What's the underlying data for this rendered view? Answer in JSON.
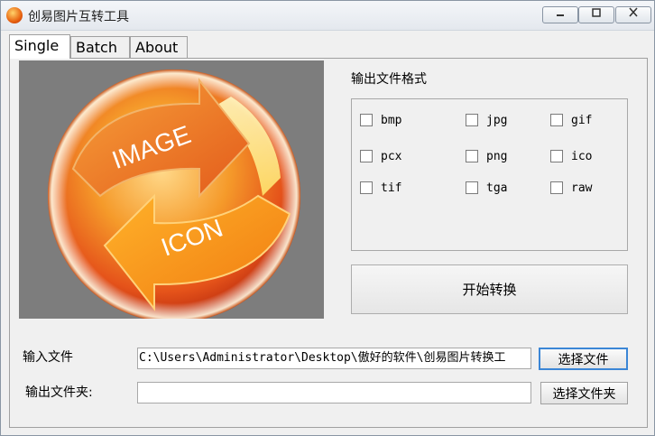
{
  "window": {
    "title": "创易图片互转工具",
    "minimize": "▭",
    "maximize": "□",
    "close": "✕"
  },
  "tabs": [
    {
      "label": "Single",
      "active": true
    },
    {
      "label": "Batch",
      "active": false
    },
    {
      "label": "About",
      "active": false
    }
  ],
  "logo": {
    "top_text": "IMAGE",
    "bottom_text": "ICON"
  },
  "formats": {
    "label": "输出文件格式",
    "options": [
      {
        "label": "bmp",
        "checked": false
      },
      {
        "label": "jpg",
        "checked": false
      },
      {
        "label": "gif",
        "checked": false
      },
      {
        "label": "pcx",
        "checked": false
      },
      {
        "label": "png",
        "checked": false
      },
      {
        "label": "ico",
        "checked": false
      },
      {
        "label": "tif",
        "checked": false
      },
      {
        "label": "tga",
        "checked": false
      },
      {
        "label": "raw",
        "checked": false
      }
    ]
  },
  "convert_button": "开始转换",
  "input_file": {
    "label": "输入文件",
    "value": "C:\\Users\\Administrator\\Desktop\\傲好的软件\\创易图片转换工",
    "button": "选择文件"
  },
  "output_folder": {
    "label": "输出文件夹:",
    "value": "",
    "button": "选择文件夹"
  },
  "colors": {
    "logo_bg": "#7d7d7d",
    "accent_orange": "#f08a1c",
    "focus_border": "#3b86d6"
  }
}
